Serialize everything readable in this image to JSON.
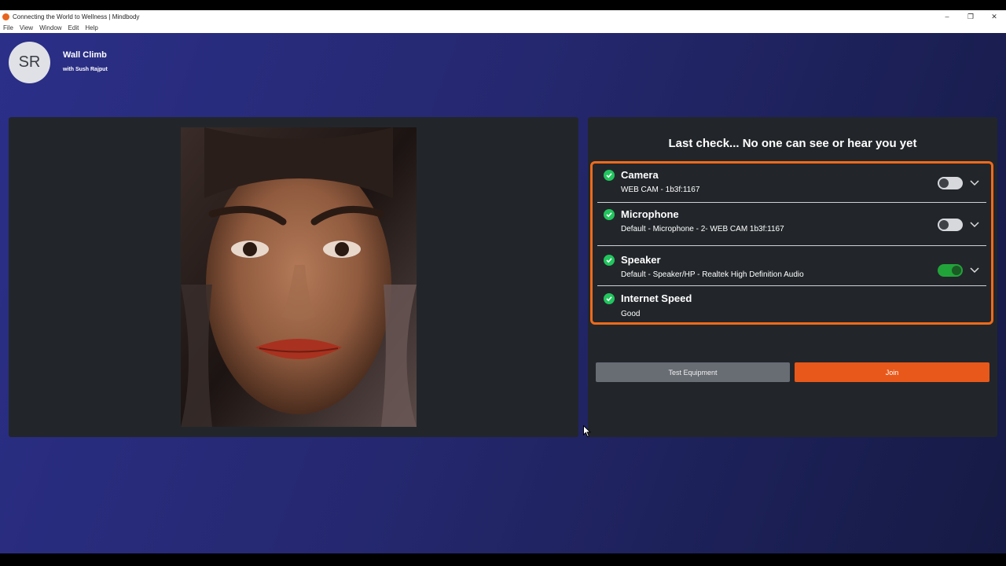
{
  "window": {
    "title": "Connecting the World to Wellness | Mindbody",
    "controls": [
      "–",
      "❐",
      "✕"
    ]
  },
  "menu": [
    "File",
    "View",
    "Window",
    "Edit",
    "Help"
  ],
  "session": {
    "avatar_initials": "SR",
    "class_name": "Wall Climb",
    "instructor": "with Sush Rajput"
  },
  "check": {
    "title": "Last check... No one can see or hear you yet",
    "devices": [
      {
        "name": "Camera",
        "detail": "WEB CAM - 1b3f:1167",
        "toggle": "off",
        "expandable": true
      },
      {
        "name": "Microphone",
        "detail": "Default - Microphone - 2- WEB CAM 1b3f:1167",
        "toggle": "off",
        "expandable": true
      },
      {
        "name": "Speaker",
        "detail": "Default - Speaker/HP - Realtek High Definition Audio",
        "toggle": "on",
        "expandable": true
      },
      {
        "name": "Internet Speed",
        "detail": "Good",
        "toggle": null,
        "expandable": false
      }
    ],
    "test_button": "Test Equipment",
    "join_button": "Join"
  },
  "colors": {
    "accent": "#e8581a",
    "highlight_border": "#f06a1a",
    "success": "#22c55e",
    "panel": "#22262a",
    "background_start": "#2b2f88",
    "background_end": "#151a44"
  }
}
